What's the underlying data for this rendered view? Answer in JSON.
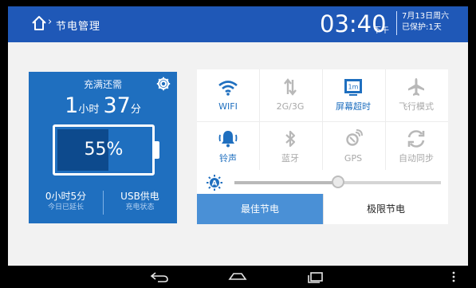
{
  "header": {
    "title": "节电管理",
    "time": "03:40",
    "ampm": "下午",
    "date": "7月13日周六",
    "protect": "已保护:1天"
  },
  "battery_card": {
    "title": "充满还需",
    "hours": "1",
    "hours_unit": "小时",
    "minutes": "37",
    "minutes_unit": "分",
    "percent": 55,
    "percent_label": "55%",
    "extended_value": "0小时5分",
    "extended_label": "今日已延长",
    "charge_value": "USB供电",
    "charge_label": "充电状态"
  },
  "toggles": [
    {
      "label": "WIFI",
      "icon": "wifi-icon",
      "on": true
    },
    {
      "label": "2G/3G",
      "icon": "mobile-data-icon",
      "on": false
    },
    {
      "label": "屏幕超时",
      "icon": "screen-timeout-icon",
      "on": true
    },
    {
      "label": "飞行模式",
      "icon": "airplane-icon",
      "on": false
    },
    {
      "label": "铃声",
      "icon": "ringer-icon",
      "on": true
    },
    {
      "label": "蓝牙",
      "icon": "bluetooth-icon",
      "on": false
    },
    {
      "label": "GPS",
      "icon": "gps-icon",
      "on": false
    },
    {
      "label": "自动同步",
      "icon": "sync-icon",
      "on": false
    }
  ],
  "screen_timeout_badge": "1m",
  "brightness": {
    "icon": "auto-brightness-icon",
    "auto_label": "A",
    "level": 0.5
  },
  "modes": {
    "best": "最佳节电",
    "extreme": "极限节电",
    "selected": "best"
  },
  "colors": {
    "header": "#1f58b7",
    "card": "#1f6fbf",
    "accent": "#1f6fbf",
    "selected_mode": "#4a90d6"
  },
  "navbar": [
    "back-icon",
    "home-icon",
    "recents-icon",
    "menu-icon"
  ]
}
